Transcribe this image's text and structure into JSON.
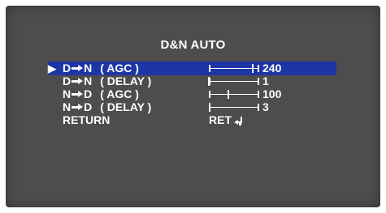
{
  "menu": {
    "title": "D&N AUTO",
    "cursor_glyph": "▶",
    "items": [
      {
        "from": "D",
        "to": "N",
        "param": "( AGC )",
        "value": "240",
        "level": 0.87,
        "selected": true
      },
      {
        "from": "D",
        "to": "N",
        "param": "( DELAY )",
        "value": "1",
        "level": 0.0,
        "selected": false
      },
      {
        "from": "N",
        "to": "D",
        "param": "( AGC )",
        "value": "100",
        "level": 0.39,
        "selected": false
      },
      {
        "from": "N",
        "to": "D",
        "param": "( DELAY )",
        "value": "3",
        "level": 0.02,
        "selected": false
      }
    ],
    "return_label": "RETURN",
    "return_value": "RET"
  },
  "colors": {
    "screen_bg": "#4d4d4d",
    "highlight": "#1d36a6",
    "text": "#ffffff"
  }
}
